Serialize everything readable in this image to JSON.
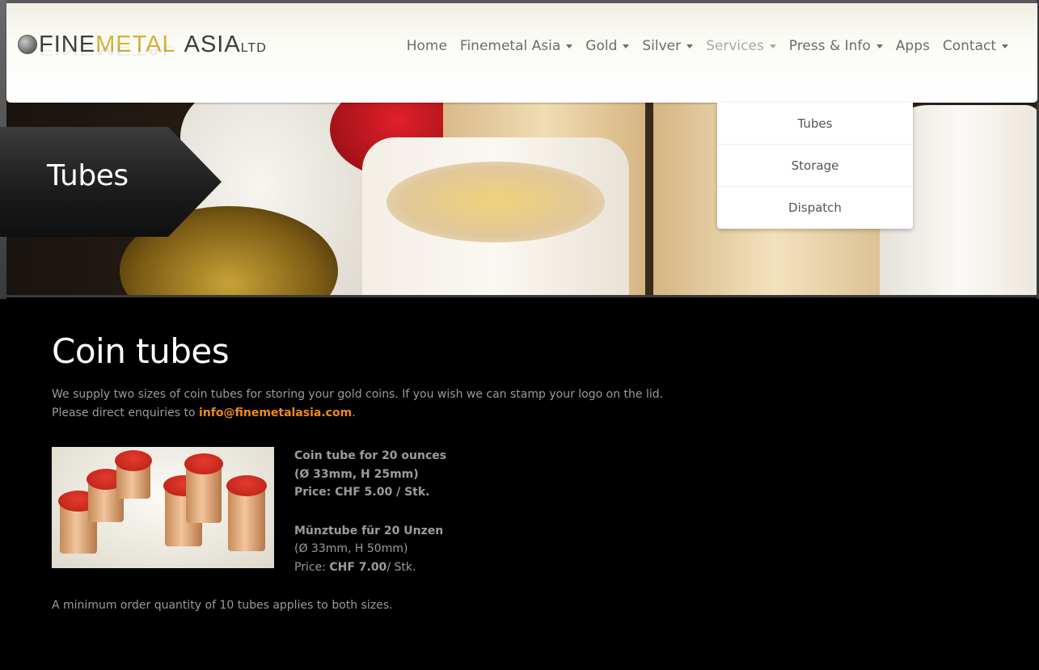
{
  "brand": {
    "fine": "FINE",
    "metal": "METAL",
    "asia": "ASIA",
    "ltd": "LTD"
  },
  "nav": {
    "items": [
      {
        "label": "Home",
        "has_caret": false
      },
      {
        "label": "Finemetal Asia",
        "has_caret": true
      },
      {
        "label": "Gold",
        "has_caret": true
      },
      {
        "label": "Silver",
        "has_caret": true
      },
      {
        "label": "Services",
        "has_caret": true,
        "active": true
      },
      {
        "label": "Press & Info",
        "has_caret": true
      },
      {
        "label": "Apps",
        "has_caret": false
      },
      {
        "label": "Contact",
        "has_caret": true
      }
    ]
  },
  "dropdown": {
    "items": [
      "Tubes",
      "Storage",
      "Dispatch"
    ]
  },
  "hero": {
    "title": "Tubes"
  },
  "content": {
    "heading": "Coin tubes",
    "intro_line1": "We supply two sizes of coin tubes for storing your gold coins. If you wish we can stamp your logo on the lid.",
    "intro_line2_prefix": "Please direct enquiries to ",
    "email": "info@finemetalasia.com",
    "intro_line2_suffix": ".",
    "product1": {
      "name": "Coin tube for 20 ounces",
      "dims": "(Ø 33mm, H 25mm)",
      "price": "Price: CHF 5.00 / Stk."
    },
    "product2": {
      "name": "Münztube für 20 Unzen",
      "dims": "(Ø 33mm, H 50mm)",
      "price_label": "Price: ",
      "price_value": "CHF 7.00",
      "price_suffix": "/ Stk."
    },
    "min_order": "A minimum order quantity of 10 tubes applies to both sizes."
  },
  "colors": {
    "accent_link": "#f08a1c",
    "logo_gold": "#d6b23a",
    "nav_text": "#6c6c6c",
    "nav_active": "#a9a9a9"
  }
}
